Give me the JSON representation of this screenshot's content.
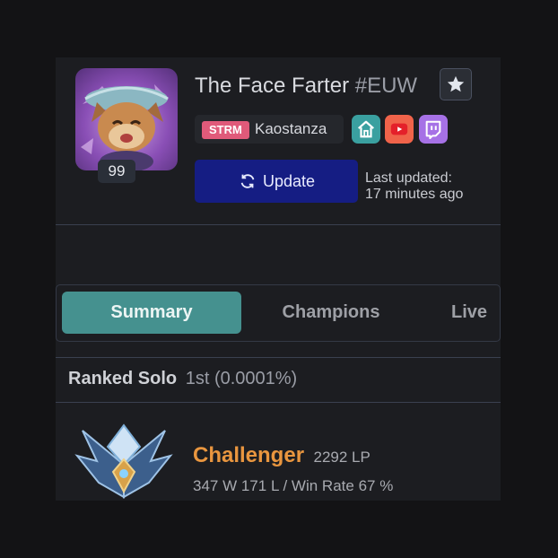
{
  "profile": {
    "summoner_name": "The Face Farter",
    "tag": "#EUW",
    "level": "99",
    "streamer_badge": "STRM",
    "streamer_name": "Kaostanza",
    "update_label": "Update",
    "last_updated_line1": "Last updated:",
    "last_updated_line2": "17 minutes ago"
  },
  "tabs": [
    {
      "label": "Summary"
    },
    {
      "label": "Champions"
    },
    {
      "label": "Live"
    }
  ],
  "ranked": {
    "title": "Ranked Solo",
    "position": "1st (0.0001%)",
    "tier": "Challenger",
    "lp": "2292 LP",
    "record": "347 W 171 L / Win Rate 67 %"
  },
  "colors": {
    "accent_teal": "#45918f",
    "update_blue": "#151d83",
    "challenger_orange": "#e9963f",
    "streamer_pink": "#e05a7a",
    "youtube_red": "#f0634a",
    "twitch_purple": "#a671e6",
    "home_teal": "#3aa0a0"
  },
  "icons": {
    "favorite": "star-icon",
    "update": "refresh-icon",
    "home": "home-icon",
    "youtube": "youtube-icon",
    "twitch": "twitch-icon"
  }
}
